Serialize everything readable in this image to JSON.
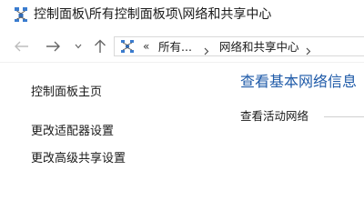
{
  "window": {
    "title": "控制面板\\所有控制面板项\\网络和共享中心",
    "icon": "network-sharing-center-icon"
  },
  "navigation": {
    "back_icon": "arrow-left-icon",
    "forward_icon": "arrow-right-icon",
    "recent_icon": "chevron-down-icon",
    "up_icon": "arrow-up-icon"
  },
  "address_bar": {
    "overflow_chevrons": "«",
    "segments": [
      "所有...",
      "网络和共享中心"
    ],
    "separator_icon": "chevron-right-icon"
  },
  "left_pane": {
    "links": [
      {
        "label": "控制面板主页"
      },
      {
        "label": "更改适配器设置"
      },
      {
        "label": "更改高级共享设置"
      }
    ]
  },
  "main": {
    "heading": "查看基本网络信息",
    "active_networks_label": "查看活动网络"
  },
  "colors": {
    "heading": "#1e5aa8",
    "text": "#1a1a1a",
    "border": "#d9d9d9"
  }
}
